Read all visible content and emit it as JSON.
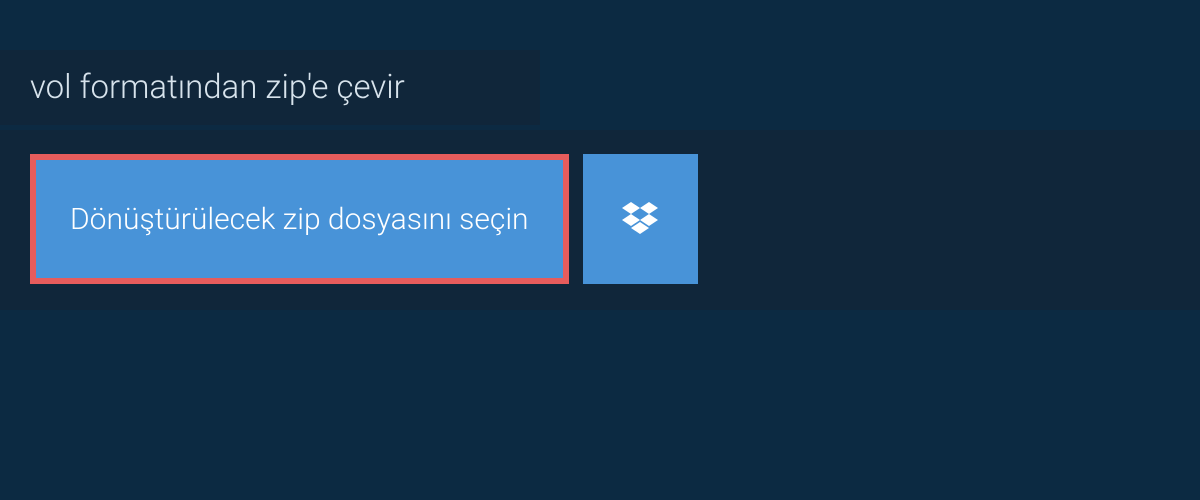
{
  "title": "vol formatından zip'e çevir",
  "actions": {
    "select_file_label": "Dönüştürülecek zip dosyasını seçin"
  },
  "colors": {
    "page_bg": "#0c2a42",
    "panel_bg": "#10263a",
    "button_bg": "#4893d8",
    "highlight_border": "#e65c5c",
    "text_light": "#d7e3ec",
    "text_white": "#ffffff"
  }
}
